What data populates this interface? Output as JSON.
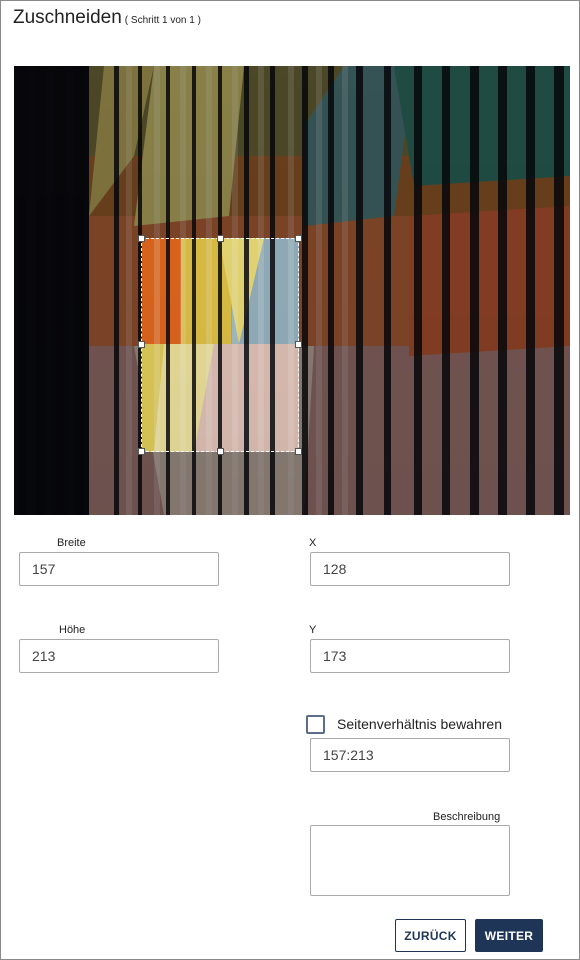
{
  "dialog": {
    "title": "Zuschneiden",
    "step": "( Schritt 1 von 1 )"
  },
  "fields": {
    "width_label": "Breite",
    "width_value": "157",
    "x_label": "X",
    "x_value": "128",
    "height_label": "Höhe",
    "height_value": "213",
    "y_label": "Y",
    "y_value": "173"
  },
  "aspect": {
    "checkbox_label": "Seitenverhältnis bewahren",
    "checked": false,
    "ratio_value": "157:213"
  },
  "description": {
    "label": "Beschreibung",
    "value": ""
  },
  "buttons": {
    "back": "ZURÜCK",
    "next": "WEITER"
  },
  "colors": {
    "primary": "#1f3557",
    "checkbox_border": "#5a6e89"
  }
}
